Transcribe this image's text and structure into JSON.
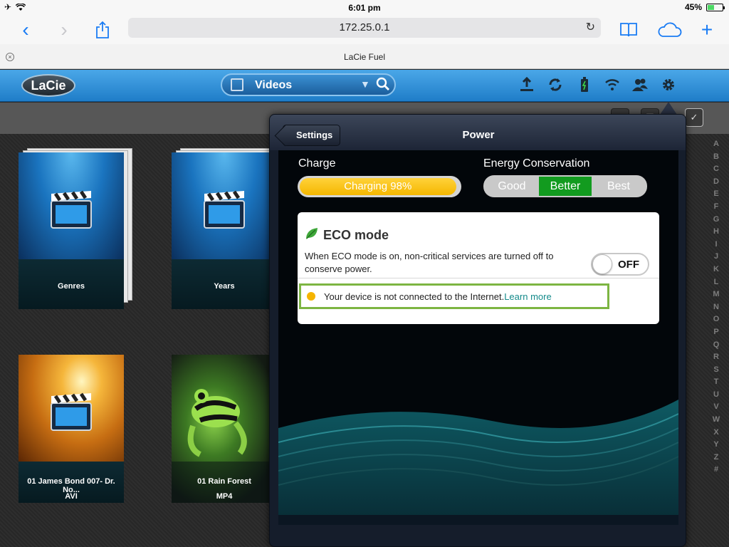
{
  "status": {
    "time": "6:01 pm",
    "battery": "45%",
    "battery_level": 0.45
  },
  "browser": {
    "url": "172.25.0.1",
    "tab_title": "LaCie Fuel"
  },
  "app": {
    "logo": "LaCie",
    "category": "Videos",
    "header_icons": [
      "upload-icon",
      "sync-icon",
      "battery-icon",
      "wifi-icon",
      "users-icon",
      "gear-icon"
    ]
  },
  "tiles": [
    {
      "caption": "Genres",
      "format": ""
    },
    {
      "caption": "Years",
      "format": ""
    },
    {
      "caption": "01 James Bond 007- Dr. No...",
      "format": "AVI"
    },
    {
      "caption": "01 Rain Forest",
      "format": "MP4"
    }
  ],
  "az_index": [
    "A",
    "B",
    "C",
    "D",
    "E",
    "F",
    "G",
    "H",
    "I",
    "J",
    "K",
    "L",
    "M",
    "N",
    "O",
    "P",
    "Q",
    "R",
    "S",
    "T",
    "U",
    "V",
    "W",
    "X",
    "Y",
    "Z",
    "#"
  ],
  "popover": {
    "back_label": "Settings",
    "title": "Power",
    "charge_label": "Charge",
    "charge_text": "Charging 98%",
    "charge_level": 0.98,
    "energy_label": "Energy Conservation",
    "energy_options": [
      "Good",
      "Better",
      "Best"
    ],
    "energy_selected": "Better",
    "eco_title": "ECO mode",
    "eco_desc": "When ECO mode is on, non-critical services are turned off to conserve power.",
    "eco_state": "OFF",
    "notice_text": "Your device is not connected to the Internet.",
    "notice_link": "Learn more"
  }
}
